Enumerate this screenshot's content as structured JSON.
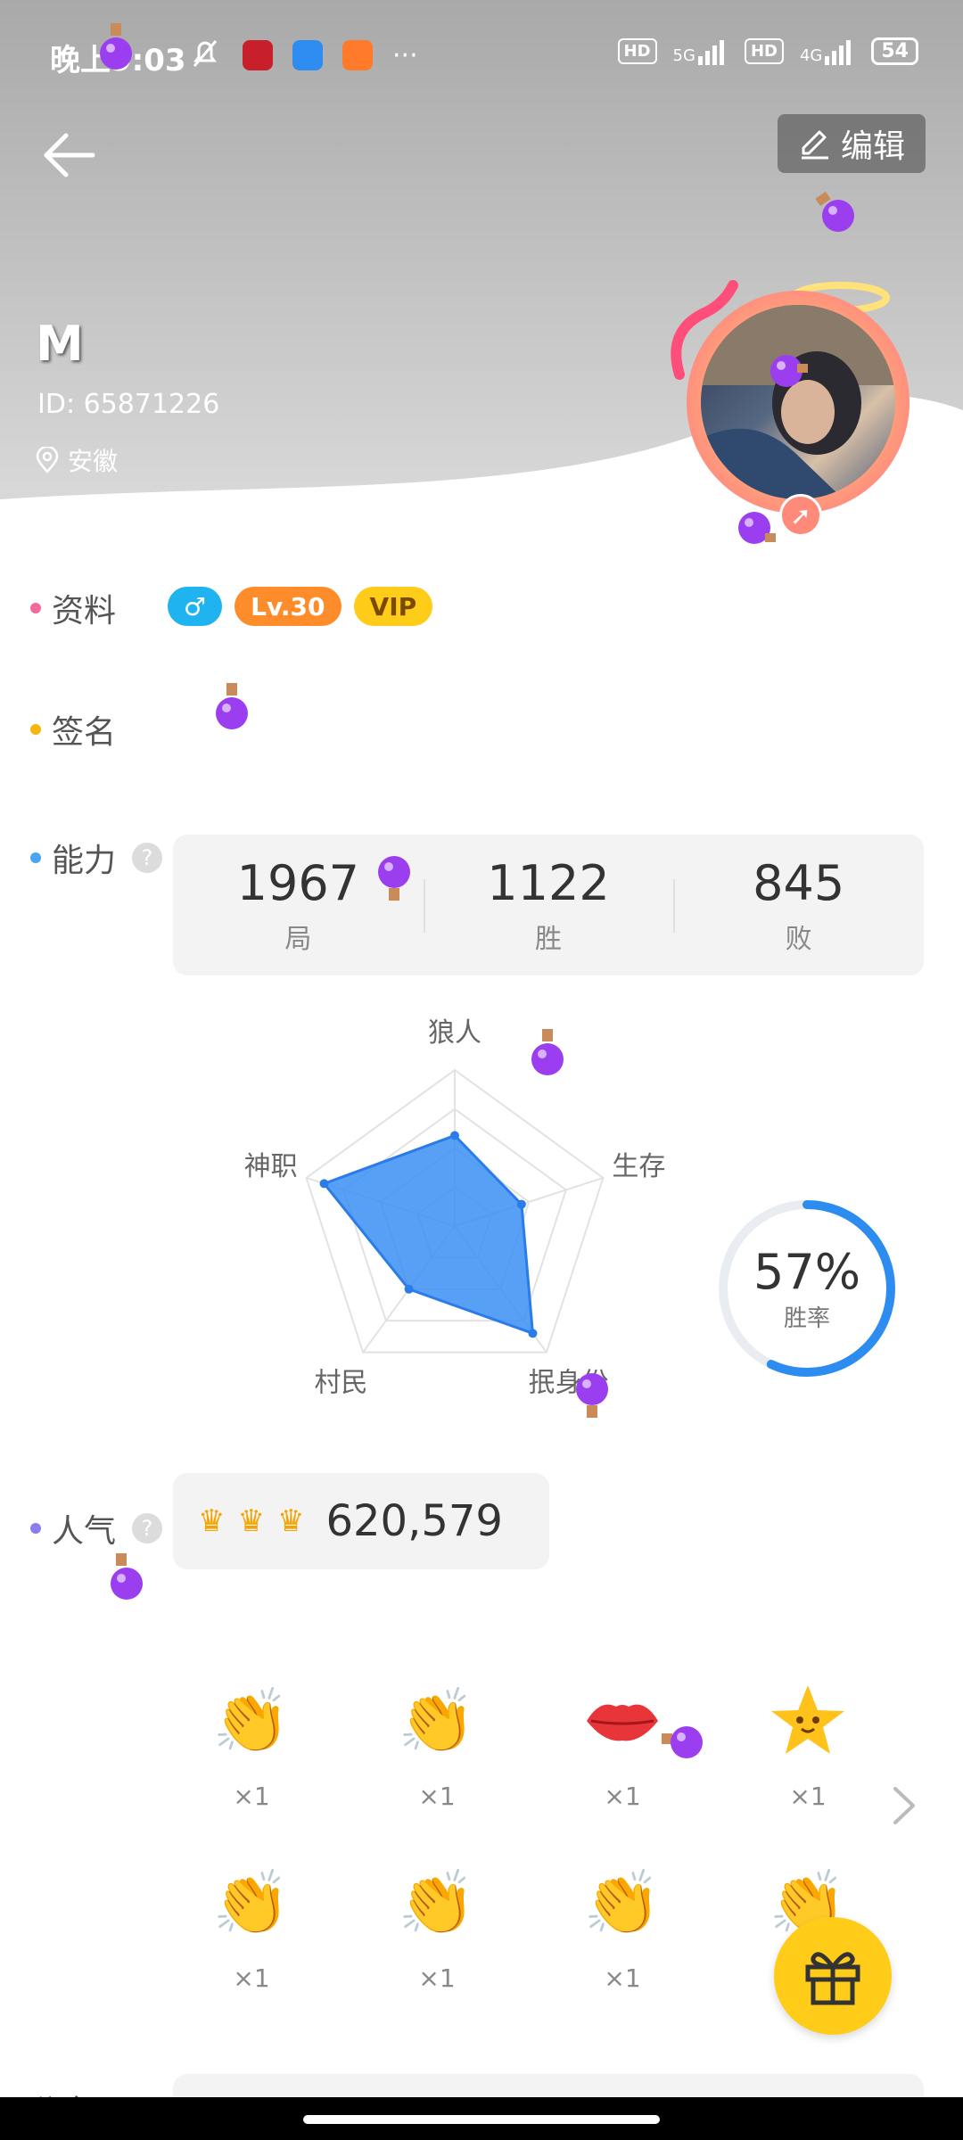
{
  "status_bar": {
    "time": "晚上9:03",
    "more": "···",
    "hd1": "HD",
    "sig1": "5G",
    "hd2": "HD",
    "sig2": "4G",
    "battery": "54"
  },
  "header": {
    "edit_label": "编辑"
  },
  "profile": {
    "name": "M",
    "id": "ID: 65871226",
    "location": "安徽"
  },
  "sections": {
    "info": "资料",
    "signature": "签名",
    "ability": "能力",
    "popularity": "人气",
    "bottom_partial": "公会"
  },
  "help_mark": "?",
  "tags": {
    "gender": "♂",
    "level": "Lv.30",
    "vip": "VIP"
  },
  "ability_stats": [
    {
      "value": "1967",
      "unit": "局"
    },
    {
      "value": "1122",
      "unit": "胜"
    },
    {
      "value": "845",
      "unit": "败"
    }
  ],
  "radar": {
    "axes": [
      "狼人",
      "生存",
      "抿身份",
      "村民",
      "神职"
    ],
    "values": [
      0.58,
      0.45,
      0.85,
      0.5,
      0.88
    ]
  },
  "winrate": {
    "value": "57%",
    "label": "胜率",
    "fraction": 0.57
  },
  "popularity": {
    "value": "620,579",
    "crowns": [
      "crown-icon",
      "crown-icon",
      "crown-icon"
    ]
  },
  "gifts": [
    {
      "icon": "clapping-hands-icon",
      "count": "×1"
    },
    {
      "icon": "clapping-hands-icon",
      "count": "×1"
    },
    {
      "icon": "lips-icon",
      "count": "×1"
    },
    {
      "icon": "star-face-icon",
      "count": "×1"
    },
    {
      "icon": "clapping-hands-icon",
      "count": "×1"
    },
    {
      "icon": "clapping-hands-icon",
      "count": "×1"
    },
    {
      "icon": "clapping-hands-icon",
      "count": "×1"
    },
    {
      "icon": "clapping-hands-icon",
      "count": ""
    }
  ],
  "colors": {
    "gender": "#1fb3f0",
    "level": "#ff8c2b",
    "vip": "#ffcc1a",
    "radar_fill": "#3b8ff5",
    "winrate_ring": "#2c8cf0",
    "dot_info": "#f06a9c",
    "dot_signature": "#f6b60f",
    "dot_ability": "#4aa3f3",
    "dot_popularity": "#8a7df0"
  }
}
